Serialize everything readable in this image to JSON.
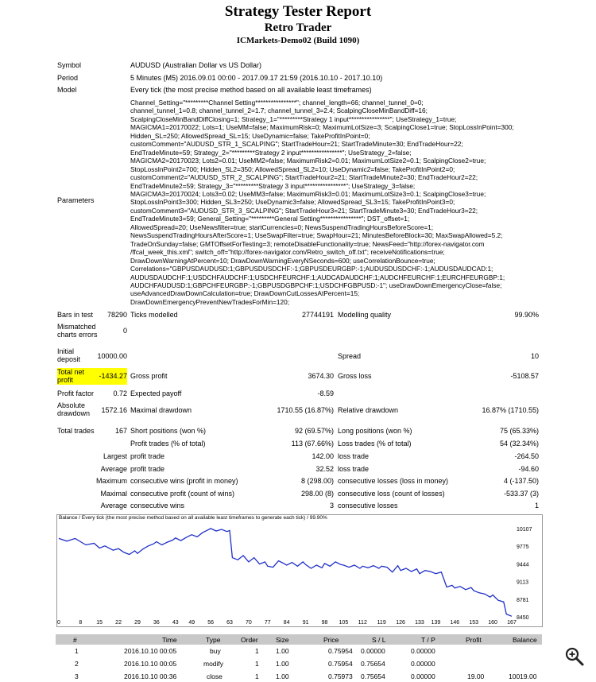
{
  "header": {
    "title": "Strategy Tester Report",
    "subtitle": "Retro Trader",
    "server": "ICMarkets-Demo02 (Build 1090)"
  },
  "info": {
    "symbol_label": "Symbol",
    "symbol": "AUDUSD (Australian Dollar vs US Dollar)",
    "period_label": "Period",
    "period": "5 Minutes (M5) 2016.09.01 00:00 - 2017.09.17 21:59 (2016.10.10 - 2017.10.10)",
    "model_label": "Model",
    "model": "Every tick (the most precise method based on all available least timeframes)",
    "parameters_label": "Parameters",
    "parameters": "Channel_Setting=\"*********Channel Setting****************\"; channel_length=66; channel_tunnel_0=0;\nchannel_tunnel_1=0.8; channel_tunnel_2=1.7; channel_tunnel_3=2.4; ScalpingCloseMinBandDiff=16;\nScalpingCloseMinBandDiffClosing=1; Strategy_1=\"*********Strategy 1 input****************\"; UseStrategy_1=true;\nMAGICMA1=20170022; Lots=1; UseMM=false; MaximumRisk=0; MaximumLotSize=3; ScalpingClose1=true; StopLossInPoint=300;\nHidden_SL=250; AllowedSpread_SL=15; UseDynamic=false; TakeProfitInPoint=0;\ncustomComment=\"AUDUSD_STR_1_SCALPING\"; StartTradeHour=21; StartTradeMinute=30; EndTradeHour=22;\nEndTradeMinute=59; Strategy_2=\"*********Strategy 2 input****************\"; UseStrategy_2=false;\nMAGICMA2=20170023; Lots2=0.01; UseMM2=false; MaximumRisk2=0.01; MaximumLotSize2=0.1; ScalpingClose2=true;\nStopLossInPoint2=700; Hidden_SL2=350; AllowedSpread_SL2=10; UseDynamic2=false; TakeProfitInPoint2=0;\ncustomComment2=\"AUDUSD_STR_2_SCALPING\"; StartTradeHour2=21; StartTradeMinute2=30; EndTradeHour2=22;\nEndTradeMinute2=59; Strategy_3=\"*********Strategy 3 input****************\"; UseStrategy_3=false;\nMAGICMA3=20170024; Lots3=0.02; UseMM3=false; MaximumRisk3=0.01; MaximumLotSize3=0.1; ScalpingClose3=true;\nStopLossInPoint3=300; Hidden_SL3=250; UseDynamic3=false; AllowedSpread_SL3=15; TakeProfitInPoint3=0;\ncustomComment3=\"AUDUSD_STR_3_SCALPING\"; StartTradeHour3=21; StartTradeMinute3=30; EndTradeHour3=22;\nEndTradeMinute3=59; General_Setting=\"*********General Setting****************\"; DST_offset=1;\nAllowedSpread=20; UseNewsfilter=true; startCurrencies=0; NewsSuspendTradingHoursBeforeScore=1;\nNewsSuspendTradingHoursAfterScore=1; UseSwapFilter=true; SwapHour=21; MinutesBeforeBlock=30; MaxSwapAllowed=5.2;\nTradeOnSunday=false; GMTOffsetForTesting=3; remoteDisableFunctionality=true; NewsFeed=\"http://forex-navigator.com\n/ffcal_week_this.xml\"; switch_off=\"http://forex-navigator.com/Retro_switch_off.txt\"; receiveNotifications=true;\nDrawDownWarningAtPercent=10; DrawDownWarningEveryNSeconds=600; useCorrelationBounce=true;\nCorrelations=\"GBPUSDAUDUSD:1;GBPUSDUSDCHF:-1;GBPUSDEURGBP:-1;AUDUSDUSDCHF:-1;AUDUSDAUDCAD:1;\nAUDUSDAUDCHF:1;USDCHFAUDCHF:1;USDCHFEURCHF:1;AUDCADAUDCHF:1;AUDCHFEURCHF:1;EURCHFEURGBP:1;\nAUDCHFAUDUSD:1;GBPCHFEURGBP:-1;GBPUSDGBPCHF:1;USDCHFGBPUSD:-1\"; useDrawDownEmergencyClose=false;\nuseAdvancedDrawDownCalculation=true; DrawDownCutLossesAtPercent=15;\nDrawDownEmergencyPreventNewTradesForMin=120;"
  },
  "stats": {
    "bars_label": "Bars in test",
    "bars": "78290",
    "ticks_label": "Ticks modelled",
    "ticks": "27744191",
    "quality_label": "Modelling quality",
    "quality": "99.90%",
    "mismatched_label": "Mismatched charts errors",
    "mismatched": "0",
    "deposit_label": "Initial deposit",
    "deposit": "10000.00",
    "spread_label": "Spread",
    "spread": "10",
    "net_label": "Total net profit",
    "net": "-1434.27",
    "gross_profit_label": "Gross profit",
    "gross_profit": "3674.30",
    "gross_loss_label": "Gross loss",
    "gross_loss": "-5108.57",
    "pf_label": "Profit factor",
    "pf": "0.72",
    "payoff_label": "Expected payoff",
    "payoff": "-8.59",
    "abs_dd_label": "Absolute drawdown",
    "abs_dd": "1572.16",
    "max_dd_label": "Maximal drawdown",
    "max_dd": "1710.55 (16.87%)",
    "rel_dd_label": "Relative drawdown",
    "rel_dd": "16.87% (1710.55)",
    "trades_label": "Total trades",
    "trades": "167",
    "short_label": "Short positions (won %)",
    "short": "92 (69.57%)",
    "long_label": "Long positions (won %)",
    "long": "75 (65.33%)",
    "pt_label": "Profit trades (% of total)",
    "pt": "113 (67.66%)",
    "lt_label": "Loss trades (% of total)",
    "lt": "54 (32.34%)",
    "largest_label": "Largest",
    "lp_label": "profit trade",
    "lp": "142.00",
    "ll_label": "loss trade",
    "ll": "-264.50",
    "average_label": "Average",
    "ap_label": "profit trade",
    "ap": "32.52",
    "al_label": "loss trade",
    "al": "-94.60",
    "maximum_label": "Maximum",
    "mcw_label": "consecutive wins (profit in money)",
    "mcw": "8 (298.00)",
    "mcl_label": "consecutive losses (loss in money)",
    "mcl": "4 (-137.50)",
    "maximal_label": "Maximal",
    "mcp_label": "consecutive profit (count of wins)",
    "mcp": "298.00 (8)",
    "mcls_label": "consecutive loss (count of losses)",
    "mcls": "-533.37 (3)",
    "average2_label": "Average",
    "acw_label": "consecutive wins",
    "acw": "3",
    "acl_label": "consecutive losses",
    "acl": "1"
  },
  "chart_data": {
    "type": "line",
    "title": "Balance / Every tick (the most precise method based on all available least timeframes to generate each tick) / 99.90%",
    "x_ticks": [
      "0",
      "8",
      "15",
      "22",
      "29",
      "36",
      "43",
      "49",
      "56",
      "63",
      "70",
      "77",
      "84",
      "91",
      "98",
      "105",
      "112",
      "119",
      "126",
      "133",
      "139",
      "146",
      "153",
      "160",
      "167"
    ],
    "y_ticks": [
      "10107",
      "9775",
      "9444",
      "9113",
      "8781",
      "8450"
    ],
    "ylim": [
      8450,
      10180
    ],
    "xlim": [
      0,
      167
    ],
    "series": [
      {
        "color": "#1f2fc8",
        "x": [
          0,
          3,
          6,
          8,
          10,
          13,
          15,
          17,
          20,
          22,
          24,
          26,
          28,
          29,
          31,
          33,
          35,
          36,
          38,
          40,
          42,
          43,
          45,
          47,
          49,
          51,
          53,
          55,
          56,
          58,
          60,
          62,
          63,
          64,
          66,
          68,
          70,
          72,
          74,
          76,
          77,
          79,
          81,
          83,
          84,
          86,
          88,
          90,
          91,
          93,
          95,
          97,
          98,
          100,
          102,
          104,
          105,
          107,
          109,
          111,
          112,
          114,
          116,
          118,
          119,
          121,
          123,
          125,
          126,
          128,
          130,
          132,
          133,
          135,
          137,
          139,
          141,
          143,
          145,
          146,
          148,
          150,
          152,
          153,
          155,
          157,
          159,
          160,
          162,
          164,
          165,
          167
        ],
        "y": [
          9920,
          9870,
          9920,
          9860,
          9800,
          9830,
          9740,
          9780,
          9700,
          9730,
          9660,
          9620,
          9690,
          9640,
          9720,
          9780,
          9820,
          9860,
          9800,
          9850,
          9890,
          9930,
          9880,
          9940,
          9990,
          9950,
          10030,
          10080,
          10107,
          10060,
          10090,
          10050,
          10070,
          9560,
          9520,
          9600,
          9480,
          9560,
          9440,
          9480,
          9400,
          9380,
          9500,
          9450,
          9420,
          9470,
          9400,
          9480,
          9430,
          9360,
          9420,
          9370,
          9450,
          9400,
          9480,
          9430,
          9420,
          9380,
          9420,
          9360,
          9400,
          9370,
          9410,
          9360,
          9400,
          9380,
          9290,
          9410,
          9320,
          9360,
          9300,
          9350,
          9260,
          9320,
          9300,
          9260,
          9290,
          9010,
          9040,
          8990,
          9020,
          8960,
          9000,
          8940,
          8900,
          8880,
          8820,
          8860,
          8760,
          8730,
          8500,
          8460
        ]
      }
    ]
  },
  "table": {
    "headers": [
      "#",
      "Time",
      "Type",
      "Order",
      "Size",
      "Price",
      "S / L",
      "T / P",
      "Profit",
      "Balance"
    ],
    "rows": [
      [
        "1",
        "2016.10.10 00:05",
        "buy",
        "1",
        "1.00",
        "0.75954",
        "0.00000",
        "0.00000",
        "",
        ""
      ],
      [
        "2",
        "2016.10.10 00:05",
        "modify",
        "1",
        "1.00",
        "0.75954",
        "0.75654",
        "0.00000",
        "",
        ""
      ],
      [
        "3",
        "2016.10.10 00:36",
        "close",
        "1",
        "1.00",
        "0.75973",
        "0.75654",
        "0.00000",
        "19.00",
        "10019.00"
      ]
    ]
  },
  "icons": {
    "zoom": "zoom-in-icon"
  }
}
